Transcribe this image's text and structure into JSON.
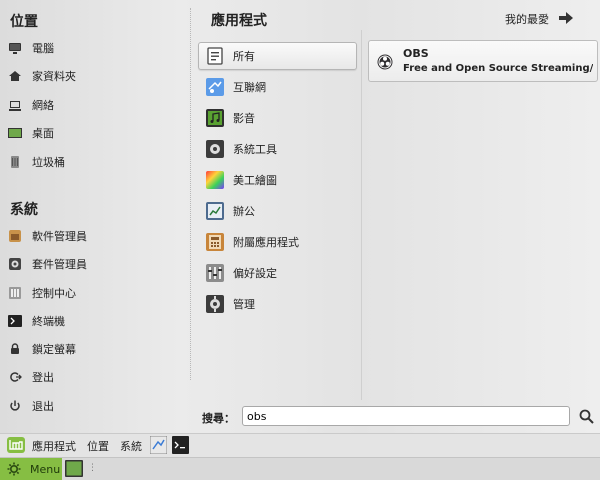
{
  "left": {
    "places_title": "位置",
    "places": [
      {
        "label": "電腦",
        "icon": "monitor-icon"
      },
      {
        "label": "家資料夾",
        "icon": "home-icon"
      },
      {
        "label": "網絡",
        "icon": "network-icon"
      },
      {
        "label": "桌面",
        "icon": "desktop-icon"
      },
      {
        "label": "垃圾桶",
        "icon": "trash-icon"
      }
    ],
    "system_title": "系統",
    "system": [
      {
        "label": "軟件管理員",
        "icon": "software-manager-icon"
      },
      {
        "label": "套件管理員",
        "icon": "package-manager-icon"
      },
      {
        "label": "控制中心",
        "icon": "control-center-icon"
      },
      {
        "label": "終端機",
        "icon": "terminal-icon"
      },
      {
        "label": "鎖定螢幕",
        "icon": "lock-icon"
      },
      {
        "label": "登出",
        "icon": "logout-icon"
      },
      {
        "label": "退出",
        "icon": "power-icon"
      }
    ]
  },
  "categories": {
    "title": "應用程式",
    "items": [
      {
        "label": "所有",
        "icon": "all-apps-icon",
        "color": "#555555"
      },
      {
        "label": "互聯網",
        "icon": "internet-icon",
        "color": "#3a7bd5"
      },
      {
        "label": "影音",
        "icon": "multimedia-icon",
        "color": "#4a8a2a"
      },
      {
        "label": "系統工具",
        "icon": "system-tools-icon",
        "color": "#555555"
      },
      {
        "label": "美工繪圖",
        "icon": "graphics-icon",
        "color": "#d03070"
      },
      {
        "label": "辦公",
        "icon": "office-icon",
        "color": "#4a6a9a"
      },
      {
        "label": "附屬應用程式",
        "icon": "accessories-icon",
        "color": "#c87a2a"
      },
      {
        "label": "偏好設定",
        "icon": "preferences-icon",
        "color": "#777777"
      },
      {
        "label": "管理",
        "icon": "administration-icon",
        "color": "#555555"
      }
    ]
  },
  "favorites_label": "我的最愛",
  "result": {
    "name": "OBS",
    "description": "Free and Open Source Streaming/Recor..."
  },
  "search": {
    "label": "搜尋：",
    "value": "obs"
  },
  "panel": {
    "apps": "應用程式",
    "places": "位置",
    "system": "系統",
    "menu": "Menu"
  },
  "colors": {
    "mint_green": "#86be43",
    "selected_bg": "#f5f5f5"
  }
}
